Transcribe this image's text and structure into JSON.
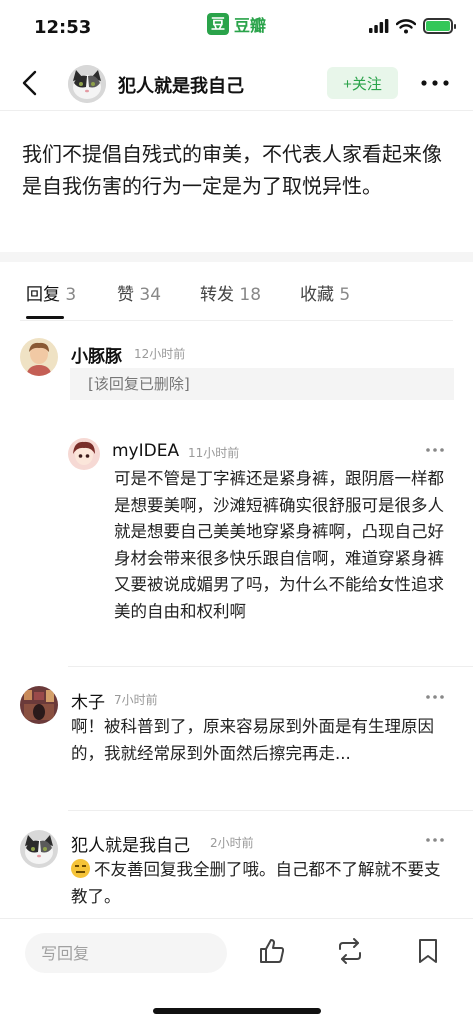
{
  "status_bar": {
    "time": "12:53",
    "app_badge_icon": "豆",
    "app_badge_name": "豆瓣"
  },
  "nav": {
    "username": "犯人就是我自己",
    "follow_label": "+关注"
  },
  "post": {
    "text": "我们不提倡自残式的审美，不代表人家看起来像是自我伤害的行为一定是为了取悦异性。"
  },
  "tabs": [
    {
      "label": "回复",
      "count": "3",
      "active": true
    },
    {
      "label": "赞",
      "count": "34"
    },
    {
      "label": "转发",
      "count": "18"
    },
    {
      "label": "收藏",
      "count": "5"
    }
  ],
  "comments": [
    {
      "user": "小豚豚",
      "time": "12小时前",
      "deleted_note": "[该回复已删除]",
      "reply": {
        "user": "myIDEA",
        "time": "11小时前",
        "text": "可是不管是丁字裤还是紧身裤，跟阴唇一样都是想要美啊，沙滩短裤确实很舒服可是很多人就是想要自己美美地穿紧身裤啊，凸现自己好身材会带来很多快乐跟自信啊，难道穿紧身裤又要被说成媚男了吗，为什么不能给女性追求美的自由和权利啊"
      }
    },
    {
      "user": "木子",
      "time": "7小时前",
      "text": "啊！被科普到了，原来容易尿到外面是有生理原因的，我就经常尿到外面然后擦完再走..."
    },
    {
      "user": "犯人就是我自己",
      "time": "2小时前",
      "text": "不友善回复我全删了哦。自己都不了解就不要支教了。"
    }
  ],
  "bottom_bar": {
    "reply_placeholder": "写回复"
  },
  "colors": {
    "brand_green": "#2aa34a",
    "follow_bg": "#e8f6ea"
  }
}
